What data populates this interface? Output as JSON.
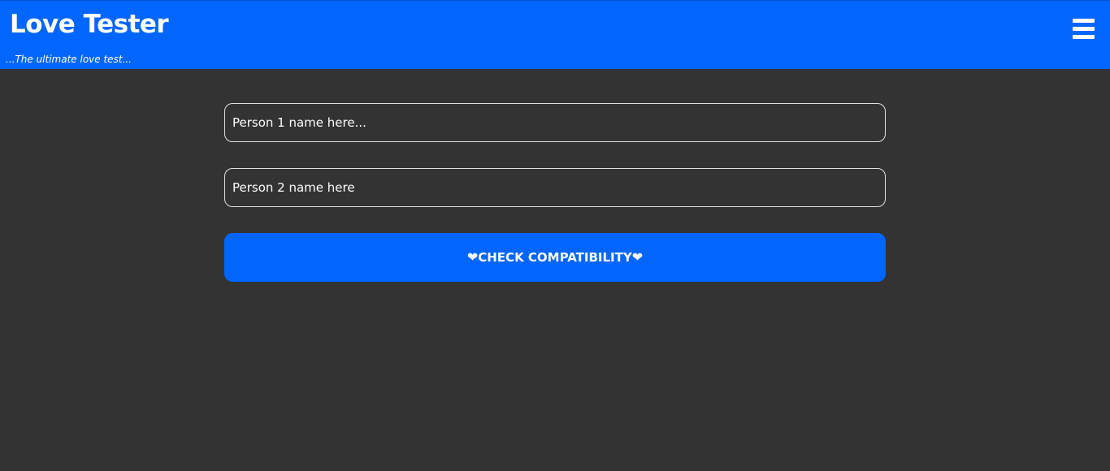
{
  "header": {
    "title": "Love Tester",
    "subtitle": "...The ultimate love test..."
  },
  "menu": {
    "icon": "hamburger-menu-icon"
  },
  "form": {
    "person1": {
      "value": "",
      "placeholder": "Person 1 name here..."
    },
    "person2": {
      "value": "",
      "placeholder": "Person 2 name here"
    },
    "check_button": {
      "label": "CHECK COMPATIBILITY",
      "icon_left": "heart",
      "icon_right": "heart"
    }
  },
  "colors": {
    "accent": "#0066ff",
    "background": "#333333",
    "text": "#ffffff",
    "input_border": "#e0e0e0"
  }
}
